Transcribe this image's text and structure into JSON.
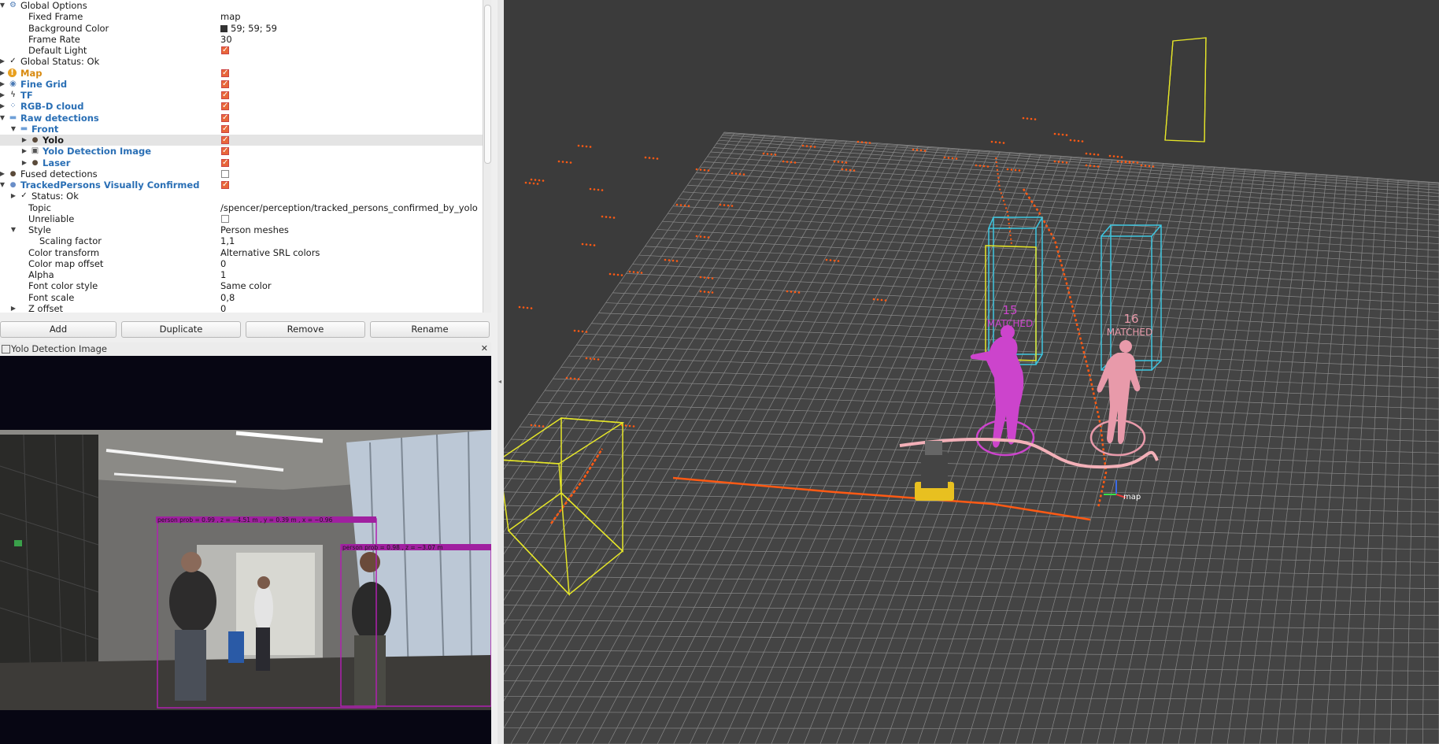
{
  "tree": [
    {
      "indent": 0,
      "arrow": "▼",
      "icon": "gear-icon",
      "label": "Global Options",
      "style": "",
      "value": null
    },
    {
      "indent": 1,
      "arrow": "",
      "icon": "",
      "label": "Fixed Frame",
      "style": "",
      "value": "map"
    },
    {
      "indent": 1,
      "arrow": "",
      "icon": "",
      "label": "Background Color",
      "style": "",
      "value": "59; 59; 59",
      "swatch": "#3b3b3b"
    },
    {
      "indent": 1,
      "arrow": "",
      "icon": "",
      "label": "Frame Rate",
      "style": "",
      "value": "30"
    },
    {
      "indent": 1,
      "arrow": "",
      "icon": "",
      "label": "Default Light",
      "style": "",
      "checkbox": true
    },
    {
      "indent": 0,
      "arrow": "▶",
      "icon": "checkmark-icon",
      "label": "Global Status: Ok",
      "style": "",
      "value": null
    },
    {
      "indent": 0,
      "arrow": "▶",
      "icon": "warning-icon",
      "label": "Map",
      "style": "orange",
      "checkbox": true
    },
    {
      "indent": 0,
      "arrow": "▶",
      "icon": "grid-icon",
      "label": "Fine Grid",
      "style": "blue",
      "checkbox": true
    },
    {
      "indent": 0,
      "arrow": "▶",
      "icon": "tf-icon",
      "label": "TF",
      "style": "blue",
      "checkbox": true
    },
    {
      "indent": 0,
      "arrow": "▶",
      "icon": "pointcloud-icon",
      "label": "RGB-D cloud",
      "style": "blue",
      "checkbox": true
    },
    {
      "indent": 0,
      "arrow": "▼",
      "icon": "folder-icon",
      "label": "Raw detections",
      "style": "blue",
      "checkbox": true
    },
    {
      "indent": 1,
      "arrow": "▼",
      "icon": "folder-icon",
      "label": "Front",
      "style": "blue",
      "checkbox": true
    },
    {
      "indent": 2,
      "arrow": "▶",
      "icon": "person-icon",
      "label": "Yolo",
      "style": "bold",
      "checkbox": true,
      "selected": true
    },
    {
      "indent": 2,
      "arrow": "▶",
      "icon": "image-icon",
      "label": "Yolo Detection Image",
      "style": "blue",
      "checkbox": true
    },
    {
      "indent": 2,
      "arrow": "▶",
      "icon": "person-icon",
      "label": "Laser",
      "style": "blue",
      "checkbox": true
    },
    {
      "indent": 0,
      "arrow": "▶",
      "icon": "person-icon",
      "label": "Fused detections",
      "style": "",
      "checkbox": false
    },
    {
      "indent": 0,
      "arrow": "▼",
      "icon": "person-icon",
      "label": "TrackedPersons Visually Confirmed",
      "style": "blue",
      "checkbox": true
    },
    {
      "indent": 1,
      "arrow": "▶",
      "icon": "checkmark-icon",
      "label": "Status: Ok",
      "style": "",
      "value": null
    },
    {
      "indent": 1,
      "arrow": "",
      "icon": "",
      "label": "Topic",
      "style": "",
      "value": "/spencer/perception/tracked_persons_confirmed_by_yolo"
    },
    {
      "indent": 1,
      "arrow": "",
      "icon": "",
      "label": "Unreliable",
      "style": "",
      "checkbox": false
    },
    {
      "indent": 1,
      "arrow": "▼",
      "icon": "",
      "label": "Style",
      "style": "",
      "value": "Person meshes"
    },
    {
      "indent": 2,
      "arrow": "",
      "icon": "",
      "label": "Scaling factor",
      "style": "",
      "value": "1,1"
    },
    {
      "indent": 1,
      "arrow": "",
      "icon": "",
      "label": "Color transform",
      "style": "",
      "value": "Alternative SRL colors"
    },
    {
      "indent": 1,
      "arrow": "",
      "icon": "",
      "label": "Color map offset",
      "style": "",
      "value": "0"
    },
    {
      "indent": 1,
      "arrow": "",
      "icon": "",
      "label": "Alpha",
      "style": "",
      "value": "1"
    },
    {
      "indent": 1,
      "arrow": "",
      "icon": "",
      "label": "Font color style",
      "style": "",
      "value": "Same color"
    },
    {
      "indent": 1,
      "arrow": "",
      "icon": "",
      "label": "Font scale",
      "style": "",
      "value": "0,8"
    },
    {
      "indent": 1,
      "arrow": "▶",
      "icon": "",
      "label": "Z offset",
      "style": "",
      "value": "0"
    }
  ],
  "buttons": {
    "add": "Add",
    "duplicate": "Duplicate",
    "remove": "Remove",
    "rename": "Rename"
  },
  "image_panel": {
    "title": "Yolo Detection Image"
  },
  "detections": [
    {
      "label": "person prob = 0.99 , z = ~4.51 m , y = 0.39 m , x = ~0.96"
    },
    {
      "label": "person prob = 0.98 , z = ~3.07 m"
    }
  ],
  "viewport": {
    "tracks": [
      {
        "id": "15",
        "status": "MATCHED",
        "color": "#cc44cc"
      },
      {
        "id": "16",
        "status": "MATCHED",
        "color": "#e89aaa"
      }
    ],
    "frame_label": "map",
    "colors": {
      "laser": "#ff5a14",
      "cyan_box": "#3ec6e0",
      "yellow_box": "#e6e628",
      "grid": "#9a9a9a"
    }
  }
}
